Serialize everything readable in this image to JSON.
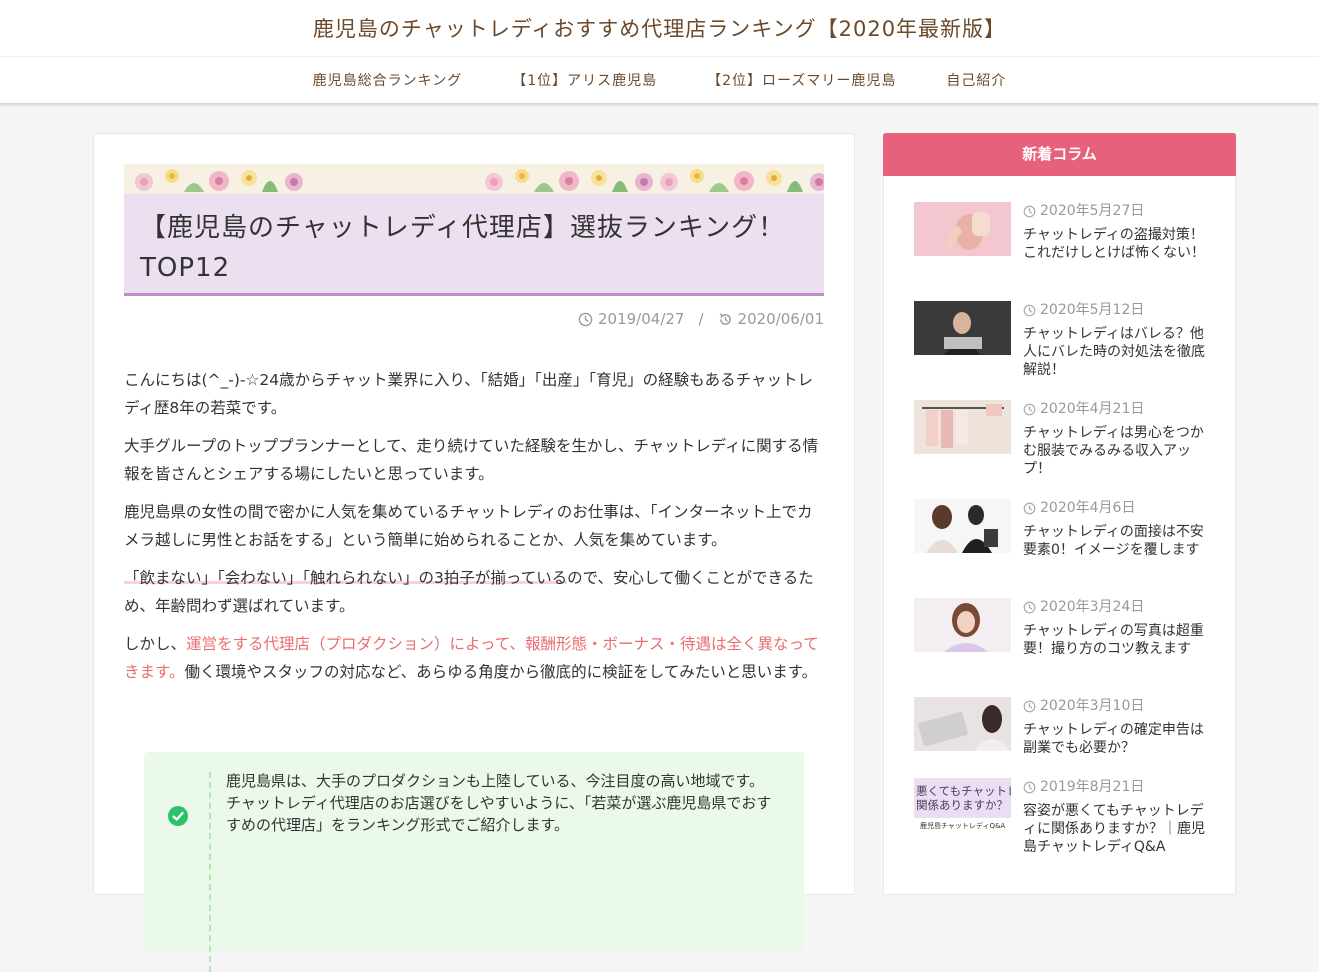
{
  "header": {
    "site_title": "鹿児島のチャットレディおすすめ代理店ランキング【2020年最新版】"
  },
  "nav": {
    "items": [
      {
        "label": "鹿児島総合ランキング"
      },
      {
        "label": "【1位】アリス鹿児島"
      },
      {
        "label": "【2位】ローズマリー鹿児島"
      },
      {
        "label": "自己紹介"
      }
    ]
  },
  "article": {
    "title": "【鹿児島のチャットレディ代理店】選抜ランキング！TOP12",
    "published": "2019/04/27",
    "separator": "/",
    "updated": "2020/06/01",
    "p1": "こんにちは(^_-)-☆24歳からチャット業界に入り、「結婚」「出産」「育児」の経験もあるチャットレディ歴8年の若菜です。",
    "p2": "大手グループのトッププランナーとして、走り続けていた経験を生かし、チャットレディに関する情報を皆さんとシェアする場にしたいと思っています。",
    "p3": "鹿児島県の女性の間で密かに人気を集めているチャットレディのお仕事は、「インターネット上でカメラ越しに男性とお話をする」という簡単に始められることか、人気を集めています。",
    "p4_highlight": "「飲まない」「会わない」「触れられない」の3拍子が揃っている",
    "p4_rest": "ので、安心して働くことができるため、年齢問わず選ばれています。",
    "p5_start": "しかし、",
    "p5_red": "運営をする代理店（プロダクション）によって、報酬形態・ボーナス・待遇は全く異なってきます。",
    "p5_end": "働く環境やスタッフの対応など、あらゆる角度から徹底的に検証をしてみたいと思います。",
    "note_line1": "鹿児島県は、大手のプロダクションも上陸している、今注目度の高い地域です。",
    "note_line2": "チャットレディ代理店のお店選びをしやすいように、「若菜が選ぶ鹿児島県でおすすめの代理店」をランキング形式でご紹介します。"
  },
  "sidebar": {
    "heading": "新着コラム",
    "posts": [
      {
        "date": "2020年5月27日",
        "title": "チャットレディの盗撮対策！これだけしとけば怖くない！"
      },
      {
        "date": "2020年5月12日",
        "title": "チャットレディはバレる？他人にバレた時の対処法を徹底解説！"
      },
      {
        "date": "2020年4月21日",
        "title": "チャットレディは男心をつかむ服装でみるみる収入アップ！"
      },
      {
        "date": "2020年4月6日",
        "title": "チャットレディの面接は不安要素0！イメージを覆します"
      },
      {
        "date": "2020年3月24日",
        "title": "チャットレディの写真は超重要！撮り方のコツ教えます"
      },
      {
        "date": "2020年3月10日",
        "title": "チャットレディの確定申告は副業でも必要か？"
      },
      {
        "date": "2019年8月21日",
        "title": "容姿が悪くてもチャットレディに関係ありますか？｜鹿児島チャットレディQ&A"
      }
    ],
    "thumb7_text_line1": "悪くてもチャットレ",
    "thumb7_text_line2": "関係ありますか？",
    "thumb7_caption": "鹿児島チャットレディQ&A"
  },
  "colors": {
    "accent": "#e8617a",
    "title_bg": "#ece0f0",
    "title_border": "#c08fc6",
    "brand_text": "#6b4a2b",
    "red_text": "#e86e70",
    "note_bg": "#ebf9ea",
    "check": "#2ec36b"
  },
  "icons": [
    "clock-icon",
    "update-icon",
    "check-circle-icon"
  ]
}
